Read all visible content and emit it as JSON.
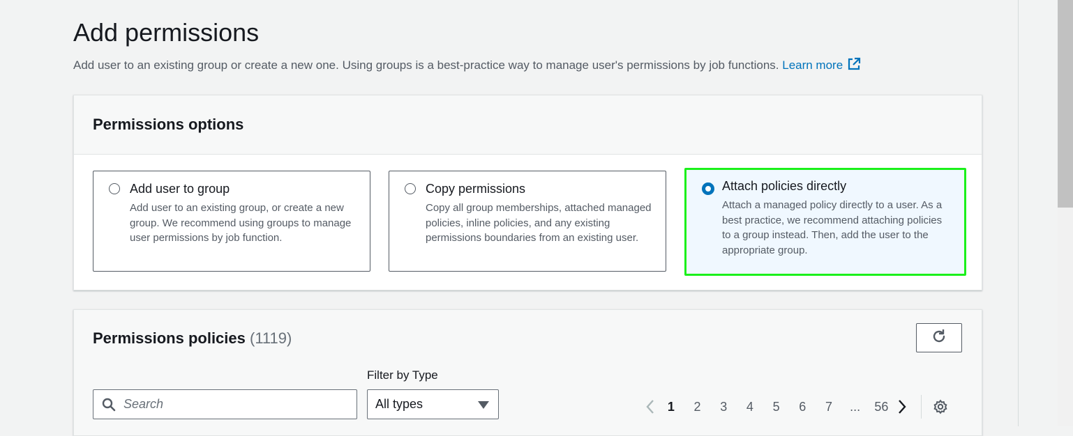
{
  "header": {
    "title": "Add permissions",
    "description": "Add user to an existing group or create a new one. Using groups is a best-practice way to manage user's permissions by job functions.",
    "learn_more": "Learn more"
  },
  "options_panel": {
    "title": "Permissions options",
    "tiles": [
      {
        "title": "Add user to group",
        "desc": "Add user to an existing group, or create a new group. We recommend using groups to manage user permissions by job function.",
        "selected": false
      },
      {
        "title": "Copy permissions",
        "desc": "Copy all group memberships, attached managed policies, inline policies, and any existing permissions boundaries from an existing user.",
        "selected": false
      },
      {
        "title": "Attach policies directly",
        "desc": "Attach a managed policy directly to a user. As a best practice, we recommend attaching policies to a group instead. Then, add the user to the appropriate group.",
        "selected": true
      }
    ]
  },
  "policies_panel": {
    "title": "Permissions policies",
    "count": "(1119)",
    "filter_label": "Filter by Type",
    "search_placeholder": "Search",
    "filter_value": "All types",
    "pages": [
      "1",
      "2",
      "3",
      "4",
      "5",
      "6",
      "7",
      "...",
      "56"
    ],
    "current_page": "1"
  },
  "colors": {
    "accent": "#0073bb",
    "highlight": "#1bf01b"
  },
  "icons": [
    "external-link-icon",
    "refresh-icon",
    "search-icon",
    "caret-down-icon",
    "chevron-left-icon",
    "chevron-right-icon",
    "gear-icon"
  ]
}
